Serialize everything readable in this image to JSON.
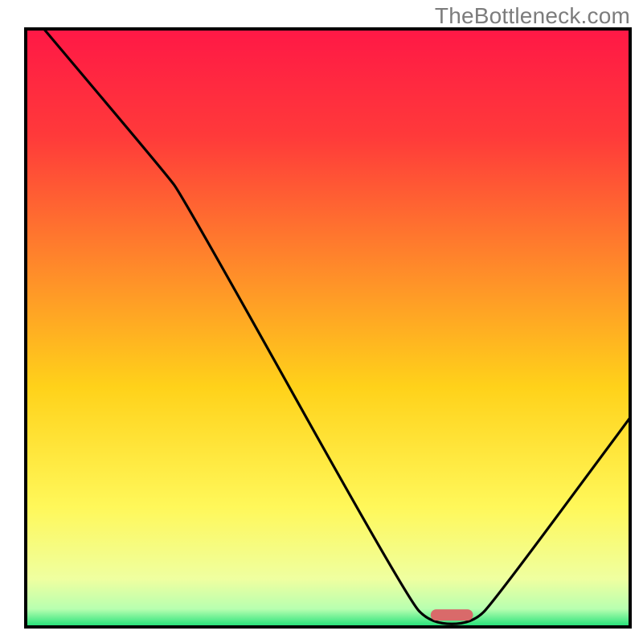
{
  "watermark": "TheBottleneck.com",
  "chart_data": {
    "type": "line",
    "title": "",
    "xlabel": "",
    "ylabel": "",
    "xlim": [
      0,
      100
    ],
    "ylim": [
      0,
      100
    ],
    "gradient_stops": [
      {
        "offset": 0.0,
        "color": "#ff1846"
      },
      {
        "offset": 0.18,
        "color": "#ff3a3a"
      },
      {
        "offset": 0.4,
        "color": "#ff8a2a"
      },
      {
        "offset": 0.6,
        "color": "#ffd21a"
      },
      {
        "offset": 0.8,
        "color": "#fff85a"
      },
      {
        "offset": 0.92,
        "color": "#efffa0"
      },
      {
        "offset": 0.97,
        "color": "#b8ffb0"
      },
      {
        "offset": 1.0,
        "color": "#1ce076"
      }
    ],
    "curve": [
      {
        "x": 3,
        "y": 100
      },
      {
        "x": 23,
        "y": 76
      },
      {
        "x": 26,
        "y": 72
      },
      {
        "x": 63,
        "y": 5
      },
      {
        "x": 67,
        "y": 0.5
      },
      {
        "x": 74,
        "y": 0.5
      },
      {
        "x": 78,
        "y": 5
      },
      {
        "x": 100,
        "y": 35
      }
    ],
    "marker": {
      "x_start": 67,
      "x_end": 74,
      "y": 2,
      "color": "#d96a6a"
    },
    "notes": "x and y are in percent of the plotting rectangle; y=0 is the bottom baseline, y=100 is the top edge. Curve values estimated off the raster gradient background (no axis labels present)."
  }
}
